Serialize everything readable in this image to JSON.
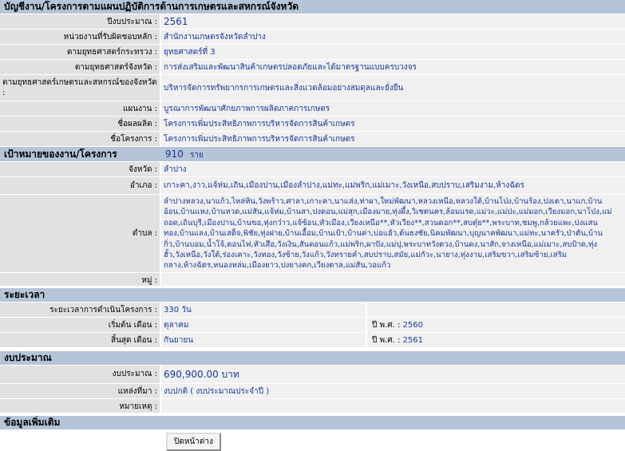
{
  "sections": {
    "main": "บัญชีงาน/โครงการตามแผนปฏิบัติการด้านการเกษตรและสหกรณ์จังหวัด",
    "target": "เป้าหมายของงาน/โครงการ",
    "period": "ระยะเวลา",
    "budget": "งบประมาณ",
    "more": "ข้อมูลเพิ่มเติม"
  },
  "main_rows": [
    {
      "label": "ปีงบประมาณ :",
      "value": "2561"
    },
    {
      "label": "หน่วยงานที่รับผิดชอบหลัก :",
      "value": "สำนักงานเกษตรจังหวัดลำปาง"
    },
    {
      "label": "ตามยุทธศาสตร์กระทรวง :",
      "value": "ยุทธศาสตร์ที่ 3"
    },
    {
      "label": "ตามยุทธศาสตร์จังหวัด :",
      "value": "การส่งเสริมและพัฒนาสินค้าเกษตรปลอดภัยและได้มาตรฐานแบบครบวงจร"
    },
    {
      "label": "ตามยุทธศาสตร์เกษตรและสหกรณ์ของจังหวัด :",
      "value": "บริหารจัดการทรัพยากรการเกษตรและสิ่งแวดล้อมอย่างสมดุลและยั่งยืน"
    },
    {
      "label": "แผนงาน :",
      "value": "บูรณาการพัฒนาศักยภาพการผลิตภาคการเกษตร"
    },
    {
      "label": "ชื่อผลผลิต :",
      "value": "โครงการเพิ่มประสิทธิภาพการบริหารจัดการสินค้าเกษตร"
    },
    {
      "label": "ชื่อโครงการ :",
      "value": "โครงการเพิ่มประสิทธิภาพการบริหารจัดการสินค้าเกษตร"
    }
  ],
  "target": {
    "count": "910",
    "unit": "ราย",
    "province_label": "จังหวัด :",
    "province": "ลำปาง",
    "district_label": "อำเภอ :",
    "districts": "เกาะคา,งาว,แจ้ห่ม,เถิน,เมืองปาน,เมืองลำปาง,แม่ทะ,แม่พริก,แม่เมาะ,วังเหนือ,สบปราบ,เสริมงาม,ห้างฉัตร",
    "subdistrict_label": "ตำบล :",
    "subdistricts": "ลำปางหลวง,นาแก้ว,ไหล่หิน,วังพร้าว,ศาลา,เกาะคา,นาแส่ง,ท่าผา,ใหม่พัฒนา,หลวงเหนือ,หลวงใต้,บ้านโป่ง,บ้านร้อง,ปงเตา,นาแก,บ้านอ้อน,บ้านแหง,บ้านหวด,แม่สัน,แจ้ห่ม,บ้านสา,ปงดอน,แม่สุก,เมืองมาย,ทุ่งผึ้ง,วิเชตนคร,ล้อมแรด,แม่วะ,แม่ปะ,แม่มอก,เวียงมอก,นาโป่ง,แม่ถอด,เถินบุรี,เมืองปาน,บ้านขอ,ทุ่งกว๋าว,แจ้ซ้อน,หัวเมือง,เวียงเหนือ**,หัวเวียง**,สวนดอก**,สบตุ๋ย**,พระบาท,ชมพู,กล้วยแพะ,ปงแสนทอง,บ้านแลง,บ้านเสด็จ,พิชัย,ทุ่งฝาย,บ้านเอื้อม,บ้านเป้า,บ้านค่า,บ่อแฮ้ว,ต้นธงชัย,นิคมพัฒนา,บุญนาคพัฒนา,แม่ทะ,นาครัว,ป่าตัน,บ้านกิ่ว,บ้านบอม,น้ำโจ้,ดอนไฟ,หัวเสือ,วังเงิน,สันดอนแก้ว,แม่พริก,ผาปัง,แม่ปุ,พระบาทวังตวง,บ้านดง,นาสัก,จางเหนือ,แม่เมาะ,สบป้าด,ทุ่งฮั้ว,วังเหนือ,วังใต้,ร่องเคาะ,วังทอง,วังซ้าย,วังแก้ว,วังทรายคำ,สบปราบ,สมัย,แม่กัวะ,นายาง,ทุ่งงาม,เสริมขวา,เสริมซ้าย,เสริมกลาง,ห้างฉัตร,หนองหล่ม,เมืองยาว,ปงยางคก,เวียงตาล,แม่สัน,วอแก้ว",
    "village_label": "หมู่ :",
    "village": ""
  },
  "period": {
    "duration_label": "ระยะเวลาการดำเนินโครงการ :",
    "duration": "330 วัน",
    "start_label": "เริ่มต้น เดือน :",
    "start_month": "ตุลาคม",
    "start_year_label": "ปี พ.ศ. :",
    "start_year": "2560",
    "end_label": "สิ้นสุด เดือน :",
    "end_month": "กันยายน",
    "end_year_label": "ปี พ.ศ. :",
    "end_year": "2561"
  },
  "budget": {
    "amount_label": "งบประมาณ :",
    "amount": "690,900.00 บาท",
    "source_label": "แหล่งที่มา :",
    "source": "งบปกติ ( งบประมาณประจำปี )",
    "note_label": "หมายเหตุ :",
    "note": ""
  },
  "close_button": "ปิดหน้าต่าง"
}
